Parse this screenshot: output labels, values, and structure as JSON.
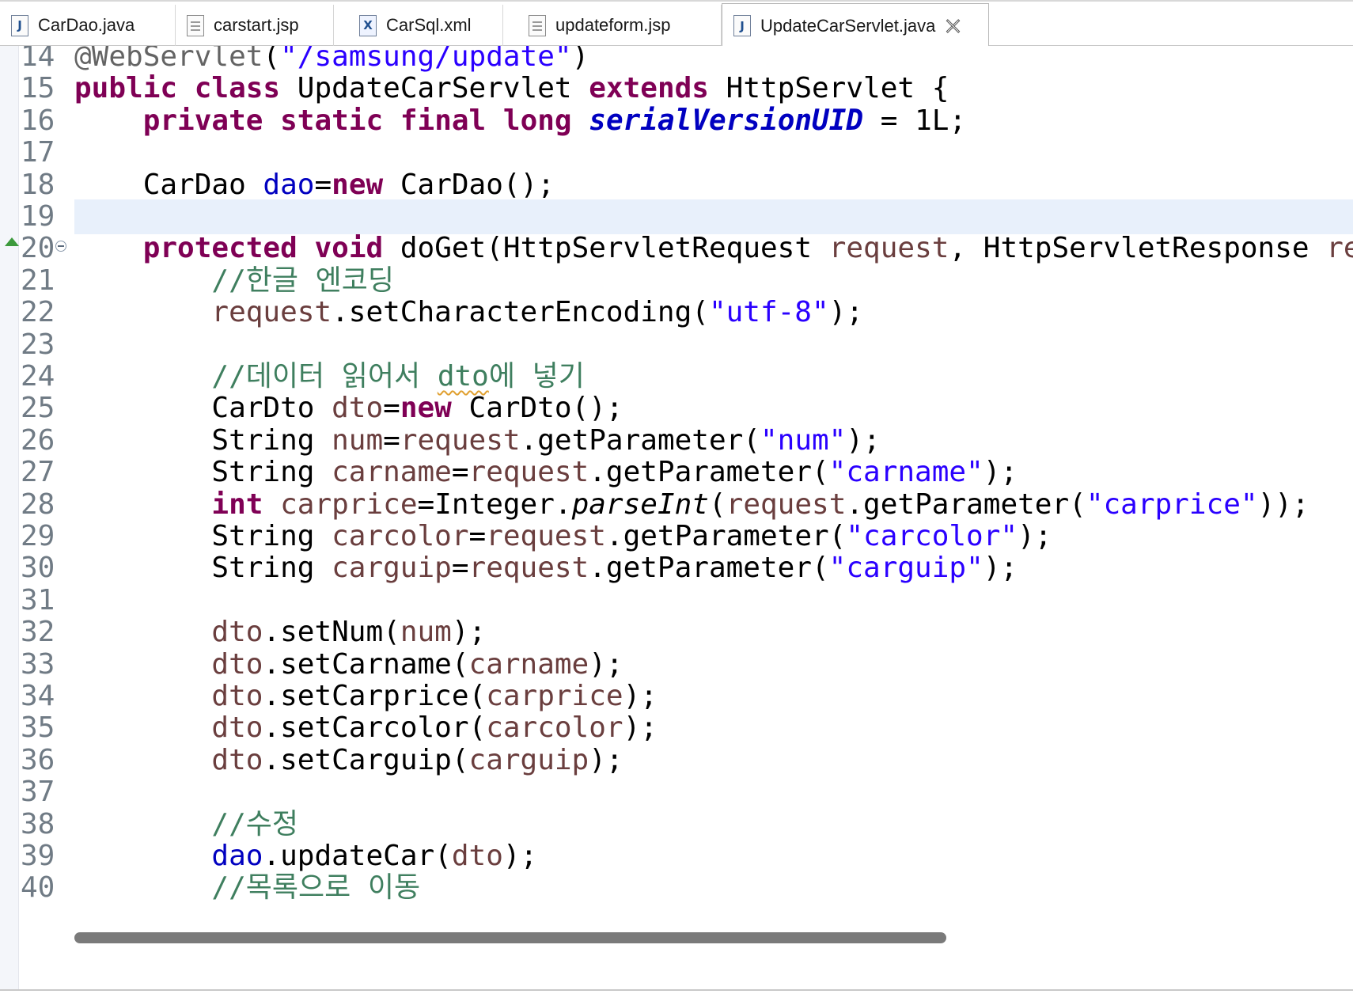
{
  "tabs": [
    {
      "label": "CarDao.java",
      "icon": "java-file-icon",
      "active": false
    },
    {
      "label": "carstart.jsp",
      "icon": "jsp-file-icon",
      "active": false
    },
    {
      "label": "CarSql.xml",
      "icon": "xml-file-icon",
      "active": false
    },
    {
      "label": "updateform.jsp",
      "icon": "jsp-file-icon",
      "active": false
    },
    {
      "label": "UpdateCarServlet.java",
      "icon": "java-file-icon",
      "active": true
    }
  ],
  "icon_glyphs": {
    "java": "J",
    "xml": "X"
  },
  "lines": [
    {
      "n": "14",
      "tokens": [
        [
          "ann",
          "@WebServlet"
        ],
        [
          "plain",
          "("
        ],
        [
          "str",
          "\"/samsung/update\""
        ],
        [
          "plain",
          ")"
        ]
      ]
    },
    {
      "n": "15",
      "tokens": [
        [
          "kw",
          "public"
        ],
        [
          "plain",
          " "
        ],
        [
          "kw",
          "class"
        ],
        [
          "plain",
          " UpdateCarServlet "
        ],
        [
          "kw",
          "extends"
        ],
        [
          "plain",
          " HttpServlet {"
        ]
      ]
    },
    {
      "n": "16",
      "tokens": [
        [
          "plain",
          "    "
        ],
        [
          "kw",
          "private"
        ],
        [
          "plain",
          " "
        ],
        [
          "kw",
          "static"
        ],
        [
          "plain",
          " "
        ],
        [
          "kw",
          "final"
        ],
        [
          "plain",
          " "
        ],
        [
          "kw",
          "long"
        ],
        [
          "plain",
          " "
        ],
        [
          "sfield",
          "serialVersionUID"
        ],
        [
          "plain",
          " = 1L;"
        ]
      ]
    },
    {
      "n": "17",
      "tokens": []
    },
    {
      "n": "18",
      "tokens": [
        [
          "plain",
          "    CarDao "
        ],
        [
          "field",
          "dao"
        ],
        [
          "plain",
          "="
        ],
        [
          "kw",
          "new"
        ],
        [
          "plain",
          " CarDao();"
        ]
      ]
    },
    {
      "n": "19",
      "tokens": [],
      "current": true
    },
    {
      "n": "20",
      "tokens": [
        [
          "plain",
          "    "
        ],
        [
          "kw",
          "protected"
        ],
        [
          "plain",
          " "
        ],
        [
          "kw",
          "void"
        ],
        [
          "plain",
          " doGet(HttpServletRequest "
        ],
        [
          "local",
          "request"
        ],
        [
          "plain",
          ", HttpServletResponse "
        ],
        [
          "local",
          "re"
        ]
      ],
      "override": true,
      "fold": true
    },
    {
      "n": "21",
      "tokens": [
        [
          "plain",
          "        "
        ],
        [
          "com",
          "//한글 엔코딩"
        ]
      ]
    },
    {
      "n": "22",
      "tokens": [
        [
          "plain",
          "        "
        ],
        [
          "local",
          "request"
        ],
        [
          "plain",
          ".setCharacterEncoding("
        ],
        [
          "str",
          "\"utf-8\""
        ],
        [
          "plain",
          ");"
        ]
      ]
    },
    {
      "n": "23",
      "tokens": []
    },
    {
      "n": "24",
      "tokens": [
        [
          "plain",
          "        "
        ],
        [
          "com",
          "//데이터 읽어서 "
        ],
        [
          "comsquig",
          "dto"
        ],
        [
          "com",
          "에 넣기"
        ]
      ]
    },
    {
      "n": "25",
      "tokens": [
        [
          "plain",
          "        CarDto "
        ],
        [
          "local",
          "dto"
        ],
        [
          "plain",
          "="
        ],
        [
          "kw",
          "new"
        ],
        [
          "plain",
          " CarDto();"
        ]
      ]
    },
    {
      "n": "26",
      "tokens": [
        [
          "plain",
          "        String "
        ],
        [
          "local",
          "num"
        ],
        [
          "plain",
          "="
        ],
        [
          "local",
          "request"
        ],
        [
          "plain",
          ".getParameter("
        ],
        [
          "str",
          "\"num\""
        ],
        [
          "plain",
          ");"
        ]
      ]
    },
    {
      "n": "27",
      "tokens": [
        [
          "plain",
          "        String "
        ],
        [
          "local",
          "carname"
        ],
        [
          "plain",
          "="
        ],
        [
          "local",
          "request"
        ],
        [
          "plain",
          ".getParameter("
        ],
        [
          "str",
          "\"carname\""
        ],
        [
          "plain",
          ");"
        ]
      ]
    },
    {
      "n": "28",
      "tokens": [
        [
          "plain",
          "        "
        ],
        [
          "kw",
          "int"
        ],
        [
          "plain",
          " "
        ],
        [
          "local",
          "carprice"
        ],
        [
          "plain",
          "=Integer."
        ],
        [
          "ital",
          "parseInt"
        ],
        [
          "plain",
          "("
        ],
        [
          "local",
          "request"
        ],
        [
          "plain",
          ".getParameter("
        ],
        [
          "str",
          "\"carprice\""
        ],
        [
          "plain",
          "));"
        ]
      ]
    },
    {
      "n": "29",
      "tokens": [
        [
          "plain",
          "        String "
        ],
        [
          "local",
          "carcolor"
        ],
        [
          "plain",
          "="
        ],
        [
          "local",
          "request"
        ],
        [
          "plain",
          ".getParameter("
        ],
        [
          "str",
          "\"carcolor\""
        ],
        [
          "plain",
          ");"
        ]
      ]
    },
    {
      "n": "30",
      "tokens": [
        [
          "plain",
          "        String "
        ],
        [
          "local",
          "carguip"
        ],
        [
          "plain",
          "="
        ],
        [
          "local",
          "request"
        ],
        [
          "plain",
          ".getParameter("
        ],
        [
          "str",
          "\"carguip\""
        ],
        [
          "plain",
          ");"
        ]
      ]
    },
    {
      "n": "31",
      "tokens": []
    },
    {
      "n": "32",
      "tokens": [
        [
          "plain",
          "        "
        ],
        [
          "local",
          "dto"
        ],
        [
          "plain",
          ".setNum("
        ],
        [
          "local",
          "num"
        ],
        [
          "plain",
          ");"
        ]
      ]
    },
    {
      "n": "33",
      "tokens": [
        [
          "plain",
          "        "
        ],
        [
          "local",
          "dto"
        ],
        [
          "plain",
          ".setCarname("
        ],
        [
          "local",
          "carname"
        ],
        [
          "plain",
          ");"
        ]
      ]
    },
    {
      "n": "34",
      "tokens": [
        [
          "plain",
          "        "
        ],
        [
          "local",
          "dto"
        ],
        [
          "plain",
          ".setCarprice("
        ],
        [
          "local",
          "carprice"
        ],
        [
          "plain",
          ");"
        ]
      ]
    },
    {
      "n": "35",
      "tokens": [
        [
          "plain",
          "        "
        ],
        [
          "local",
          "dto"
        ],
        [
          "plain",
          ".setCarcolor("
        ],
        [
          "local",
          "carcolor"
        ],
        [
          "plain",
          ");"
        ]
      ]
    },
    {
      "n": "36",
      "tokens": [
        [
          "plain",
          "        "
        ],
        [
          "local",
          "dto"
        ],
        [
          "plain",
          ".setCarguip("
        ],
        [
          "local",
          "carguip"
        ],
        [
          "plain",
          ");"
        ]
      ]
    },
    {
      "n": "37",
      "tokens": []
    },
    {
      "n": "38",
      "tokens": [
        [
          "plain",
          "        "
        ],
        [
          "com",
          "//수정"
        ]
      ]
    },
    {
      "n": "39",
      "tokens": [
        [
          "plain",
          "        "
        ],
        [
          "field",
          "dao"
        ],
        [
          "plain",
          ".updateCar("
        ],
        [
          "local",
          "dto"
        ],
        [
          "plain",
          ");"
        ]
      ]
    },
    {
      "n": "40",
      "tokens": [
        [
          "plain",
          "        "
        ],
        [
          "com",
          "//목록으로 이동"
        ]
      ]
    }
  ]
}
